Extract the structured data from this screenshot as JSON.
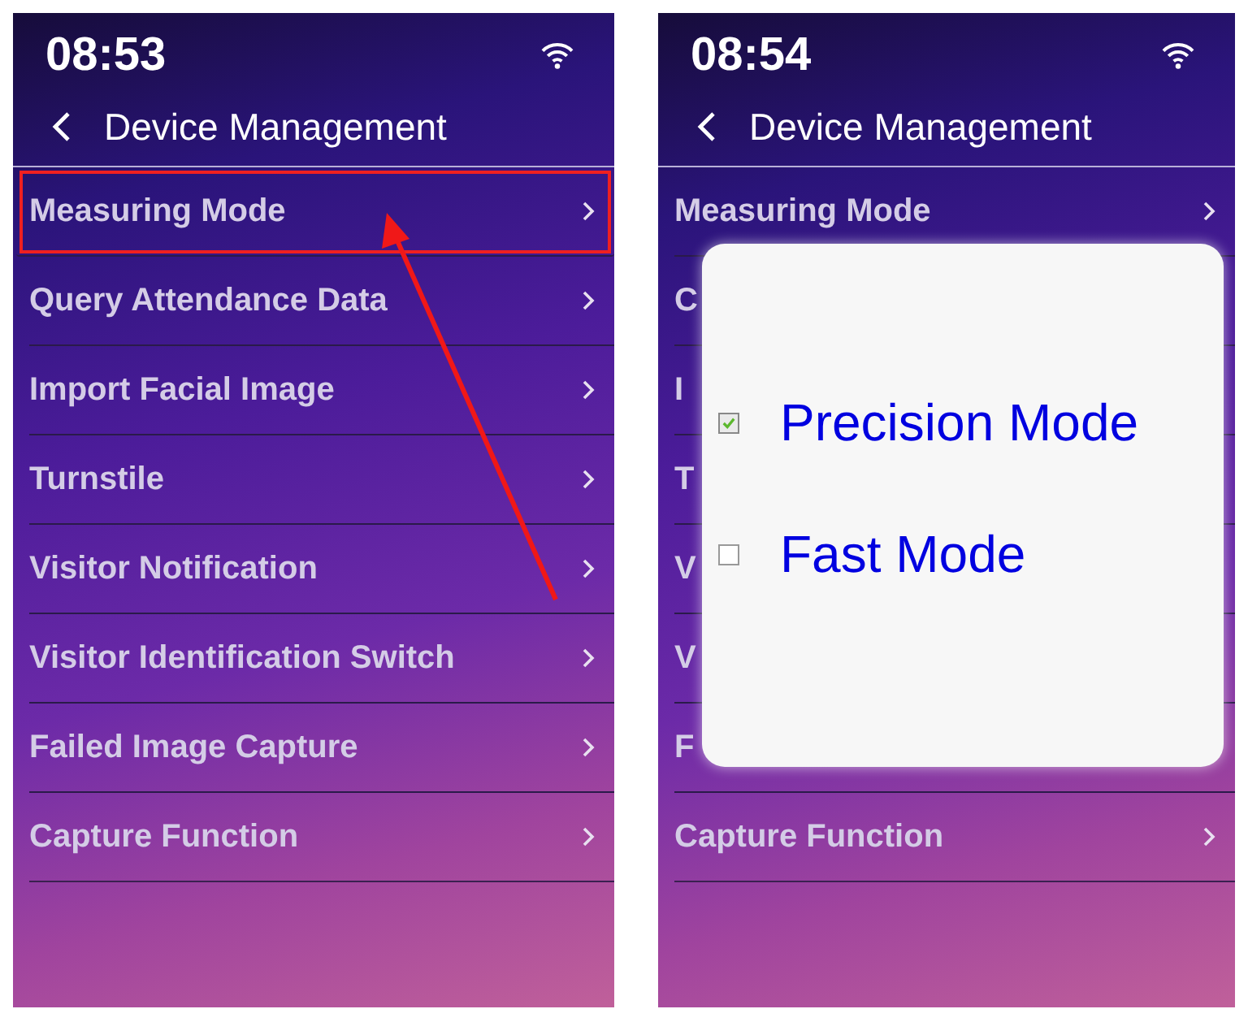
{
  "screens": [
    {
      "status_bar": {
        "time": "08:53"
      },
      "header": {
        "title": "Device Management"
      },
      "menu": [
        {
          "label": "Measuring Mode",
          "highlighted": true
        },
        {
          "label": "Query Attendance Data",
          "highlighted": false
        },
        {
          "label": "Import Facial Image",
          "highlighted": false
        },
        {
          "label": "Turnstile",
          "highlighted": false
        },
        {
          "label": "Visitor Notification",
          "highlighted": false
        },
        {
          "label": "Visitor Identification Switch",
          "highlighted": false
        },
        {
          "label": "Failed Image Capture",
          "highlighted": false
        },
        {
          "label": "Capture Function",
          "highlighted": false
        }
      ]
    },
    {
      "status_bar": {
        "time": "08:54"
      },
      "header": {
        "title": "Device Management"
      },
      "menu": [
        {
          "label": "Measuring Mode",
          "highlighted": false
        },
        {
          "label": "C",
          "highlighted": false
        },
        {
          "label": "I",
          "highlighted": false
        },
        {
          "label": "T",
          "highlighted": false
        },
        {
          "label": "V",
          "highlighted": false
        },
        {
          "label": "V",
          "highlighted": false
        },
        {
          "label": "F",
          "highlighted": false
        },
        {
          "label": "Capture Function",
          "highlighted": false
        }
      ],
      "dialog": {
        "options": [
          {
            "label": "Precision Mode",
            "checked": true
          },
          {
            "label": "Fast Mode",
            "checked": false
          }
        ]
      }
    }
  ]
}
